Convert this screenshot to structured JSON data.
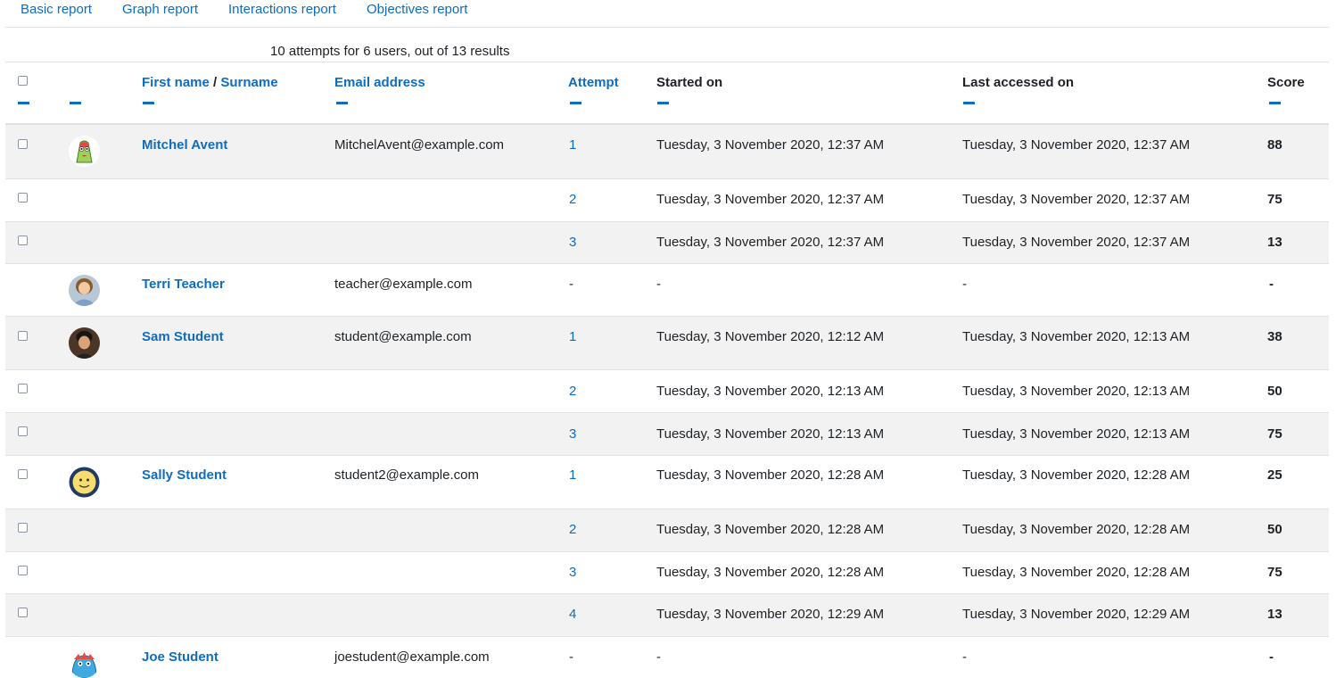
{
  "tabs": [
    "Basic report",
    "Graph report",
    "Interactions report",
    "Objectives report"
  ],
  "summary": "10 attempts for 6 users, out of 13 results",
  "columns": {
    "first_name": "First name",
    "separator": "/",
    "surname": "Surname",
    "email": "Email address",
    "attempt": "Attempt",
    "started": "Started on",
    "last_accessed": "Last accessed on",
    "score": "Score"
  },
  "rows": [
    {
      "name": "Mitchel Avent",
      "email": "MitchelAvent@example.com",
      "attempt": "1",
      "started": "Tuesday, 3 November 2020, 12:37 AM",
      "last": "Tuesday, 3 November 2020, 12:37 AM",
      "score": "88"
    },
    {
      "name": "",
      "email": "",
      "attempt": "2",
      "started": "Tuesday, 3 November 2020, 12:37 AM",
      "last": "Tuesday, 3 November 2020, 12:37 AM",
      "score": "75"
    },
    {
      "name": "",
      "email": "",
      "attempt": "3",
      "started": "Tuesday, 3 November 2020, 12:37 AM",
      "last": "Tuesday, 3 November 2020, 12:37 AM",
      "score": "13"
    },
    {
      "name": "Terri Teacher",
      "email": "teacher@example.com",
      "attempt": "-",
      "started": "-",
      "last": "-",
      "score": "-"
    },
    {
      "name": "Sam Student",
      "email": "student@example.com",
      "attempt": "1",
      "started": "Tuesday, 3 November 2020, 12:12 AM",
      "last": "Tuesday, 3 November 2020, 12:13 AM",
      "score": "38"
    },
    {
      "name": "",
      "email": "",
      "attempt": "2",
      "started": "Tuesday, 3 November 2020, 12:13 AM",
      "last": "Tuesday, 3 November 2020, 12:13 AM",
      "score": "50"
    },
    {
      "name": "",
      "email": "",
      "attempt": "3",
      "started": "Tuesday, 3 November 2020, 12:13 AM",
      "last": "Tuesday, 3 November 2020, 12:13 AM",
      "score": "75"
    },
    {
      "name": "Sally Student",
      "email": "student2@example.com",
      "attempt": "1",
      "started": "Tuesday, 3 November 2020, 12:28 AM",
      "last": "Tuesday, 3 November 2020, 12:28 AM",
      "score": "25"
    },
    {
      "name": "",
      "email": "",
      "attempt": "2",
      "started": "Tuesday, 3 November 2020, 12:28 AM",
      "last": "Tuesday, 3 November 2020, 12:28 AM",
      "score": "50"
    },
    {
      "name": "",
      "email": "",
      "attempt": "3",
      "started": "Tuesday, 3 November 2020, 12:28 AM",
      "last": "Tuesday, 3 November 2020, 12:28 AM",
      "score": "75"
    },
    {
      "name": "",
      "email": "",
      "attempt": "4",
      "started": "Tuesday, 3 November 2020, 12:29 AM",
      "last": "Tuesday, 3 November 2020, 12:29 AM",
      "score": "13"
    },
    {
      "name": "Joe Student",
      "email": "joestudent@example.com",
      "attempt": "-",
      "started": "-",
      "last": "-",
      "score": "-"
    }
  ]
}
